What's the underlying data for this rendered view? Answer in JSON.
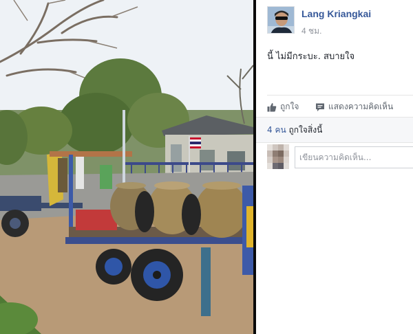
{
  "photo": {
    "description_icon": "photo-of-cart-with-clay-jars",
    "flag_icon": "thai-flag-icon"
  },
  "post": {
    "author": "Lang Kriangkai",
    "timestamp": "4 ชม.",
    "text": "นี้ ไม่มีกระบะ. สบายใจ"
  },
  "actions": {
    "like_label": "ถูกใจ",
    "comment_label": "แสดงความคิดเห็น",
    "like_icon": "thumbs-up-icon",
    "comment_icon": "speech-bubble-icon"
  },
  "likes": {
    "count": "4 คน",
    "text": "ถูกใจสิ่งนี้"
  },
  "comment": {
    "placeholder": "เขียนความคิดเห็น..."
  },
  "colors": {
    "link": "#365899",
    "meta": "#90949c",
    "action": "#606770",
    "text": "#1d2129",
    "likes_bg": "#f6f7f9"
  }
}
